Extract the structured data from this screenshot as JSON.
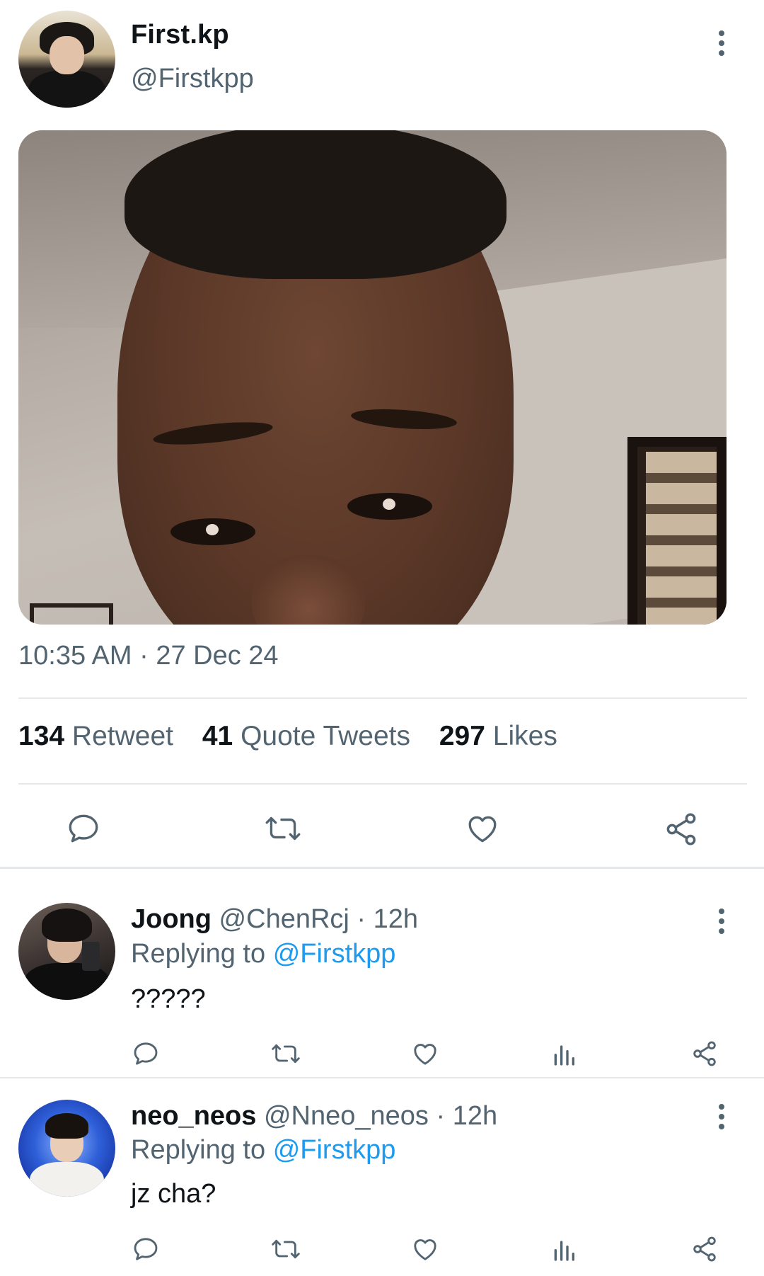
{
  "tweet": {
    "author_name": "First.kp",
    "author_handle": "@Firstkpp",
    "timestamp": "10:35 AM · 27 Dec 24",
    "stats": {
      "retweets_count": "134",
      "retweets_label": "Retweet",
      "quotes_count": "41",
      "quotes_label": "Quote Tweets",
      "likes_count": "297",
      "likes_label": "Likes"
    },
    "actions": [
      "reply-icon",
      "retweet-icon",
      "like-icon",
      "share-icon"
    ]
  },
  "replies": [
    {
      "name": "Joong",
      "handle": "@ChenRcj",
      "time": "· 12h",
      "replying_prefix": "Replying to",
      "replying_to": "@Firstkpp",
      "text": "?????"
    },
    {
      "name": "neo_neos",
      "handle": "@Nneo_neos",
      "time": "· 12h",
      "replying_prefix": "Replying to",
      "replying_to": "@Firstkpp",
      "text": "jz cha?"
    }
  ],
  "colors": {
    "text_primary": "#0f1419",
    "text_secondary": "#536471",
    "link": "#1d9bf0",
    "divider": "#e6e9eb"
  }
}
